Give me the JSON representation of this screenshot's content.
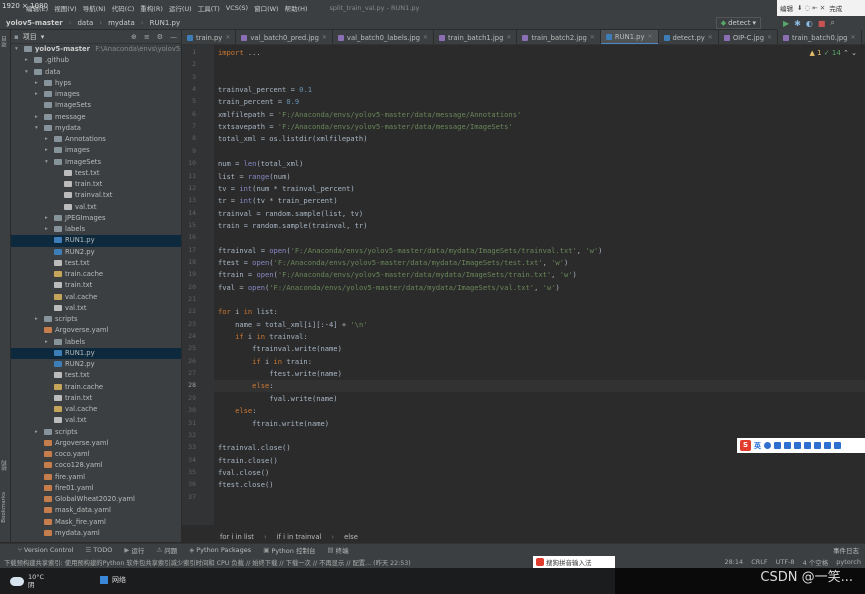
{
  "screen": {
    "resolution_badge": "1920 × 1080"
  },
  "menubar": {
    "items": [
      "编辑(E)",
      "视图(V)",
      "导航(N)",
      "代码(C)",
      "重构(R)",
      "运行(U)",
      "工具(T)",
      "VCS(S)",
      "窗口(W)",
      "帮助(H)"
    ],
    "window_title": "split_train_val.py - RUN1.py"
  },
  "navbar": {
    "breadcrumbs": [
      "yolov5-master",
      "data",
      "mydata",
      "RUN1.py"
    ],
    "run_config": "detect"
  },
  "ime_top": {
    "labels": [
      "编辑",
      "完成"
    ]
  },
  "left_strip": {
    "labels": [
      "项目",
      "结构",
      "Bookmarks"
    ]
  },
  "project": {
    "header": "项目",
    "root_label": "yolov5-master",
    "root_path": "F:\\Anaconda\\envs\\yolov5-m",
    "items": [
      {
        "label": ".github",
        "kind": "folder",
        "depth": 1,
        "arrow": "▸"
      },
      {
        "label": "data",
        "kind": "folder",
        "depth": 1,
        "arrow": "▾"
      },
      {
        "label": "hyps",
        "kind": "folder",
        "depth": 2,
        "arrow": "▸"
      },
      {
        "label": "images",
        "kind": "folder",
        "depth": 2,
        "arrow": "▸"
      },
      {
        "label": "ImageSets",
        "kind": "folder",
        "depth": 2,
        "arrow": ""
      },
      {
        "label": "message",
        "kind": "folder",
        "depth": 2,
        "arrow": "▸"
      },
      {
        "label": "mydata",
        "kind": "folder",
        "depth": 2,
        "arrow": "▾"
      },
      {
        "label": "Annotations",
        "kind": "folder",
        "depth": 3,
        "arrow": "▸"
      },
      {
        "label": "images",
        "kind": "folder",
        "depth": 3,
        "arrow": "▸"
      },
      {
        "label": "ImageSets",
        "kind": "folder",
        "depth": 3,
        "arrow": "▾"
      },
      {
        "label": "test.txt",
        "kind": "txt",
        "depth": 4,
        "arrow": ""
      },
      {
        "label": "train.txt",
        "kind": "txt",
        "depth": 4,
        "arrow": ""
      },
      {
        "label": "trainval.txt",
        "kind": "txt",
        "depth": 4,
        "arrow": ""
      },
      {
        "label": "val.txt",
        "kind": "txt",
        "depth": 4,
        "arrow": ""
      },
      {
        "label": "JPEGImages",
        "kind": "folder",
        "depth": 3,
        "arrow": "▸"
      },
      {
        "label": "labels",
        "kind": "folder",
        "depth": 3,
        "arrow": "▸"
      },
      {
        "label": "RUN1.py",
        "kind": "py",
        "depth": 3,
        "arrow": "",
        "selected": true
      },
      {
        "label": "RUN2.py",
        "kind": "py",
        "depth": 3,
        "arrow": ""
      },
      {
        "label": "test.txt",
        "kind": "txt",
        "depth": 3,
        "arrow": ""
      },
      {
        "label": "train.cache",
        "kind": "cache",
        "depth": 3,
        "arrow": ""
      },
      {
        "label": "train.txt",
        "kind": "txt",
        "depth": 3,
        "arrow": ""
      },
      {
        "label": "val.cache",
        "kind": "cache",
        "depth": 3,
        "arrow": ""
      },
      {
        "label": "val.txt",
        "kind": "txt",
        "depth": 3,
        "arrow": ""
      },
      {
        "label": "scripts",
        "kind": "folder",
        "depth": 2,
        "arrow": "▸"
      },
      {
        "label": "Argoverse.yaml",
        "kind": "yaml",
        "depth": 2,
        "arrow": ""
      },
      {
        "label": "labels",
        "kind": "folder",
        "depth": 3,
        "arrow": "▸"
      },
      {
        "label": "RUN1.py",
        "kind": "py",
        "depth": 3,
        "arrow": "",
        "selected": true
      },
      {
        "label": "RUN2.py",
        "kind": "py",
        "depth": 3,
        "arrow": ""
      },
      {
        "label": "test.txt",
        "kind": "txt",
        "depth": 3,
        "arrow": ""
      },
      {
        "label": "train.cache",
        "kind": "cache",
        "depth": 3,
        "arrow": ""
      },
      {
        "label": "train.txt",
        "kind": "txt",
        "depth": 3,
        "arrow": ""
      },
      {
        "label": "val.cache",
        "kind": "cache",
        "depth": 3,
        "arrow": ""
      },
      {
        "label": "val.txt",
        "kind": "txt",
        "depth": 3,
        "arrow": ""
      },
      {
        "label": "scripts",
        "kind": "folder",
        "depth": 2,
        "arrow": "▸"
      },
      {
        "label": "Argoverse.yaml",
        "kind": "yaml",
        "depth": 2,
        "arrow": ""
      },
      {
        "label": "coco.yaml",
        "kind": "yaml",
        "depth": 2,
        "arrow": ""
      },
      {
        "label": "coco128.yaml",
        "kind": "yaml",
        "depth": 2,
        "arrow": ""
      },
      {
        "label": "fire.yaml",
        "kind": "yaml",
        "depth": 2,
        "arrow": ""
      },
      {
        "label": "fire01.yaml",
        "kind": "yaml",
        "depth": 2,
        "arrow": ""
      },
      {
        "label": "GlobalWheat2020.yaml",
        "kind": "yaml",
        "depth": 2,
        "arrow": ""
      },
      {
        "label": "mask_data.yaml",
        "kind": "yaml",
        "depth": 2,
        "arrow": ""
      },
      {
        "label": "Mask_fire.yaml",
        "kind": "yaml",
        "depth": 2,
        "arrow": ""
      },
      {
        "label": "mydata.yaml",
        "kind": "yaml",
        "depth": 2,
        "arrow": ""
      }
    ]
  },
  "tabs": [
    {
      "label": "train.py",
      "kind": "py"
    },
    {
      "label": "val_batch0_pred.jpg",
      "kind": "img"
    },
    {
      "label": "val_batch0_labels.jpg",
      "kind": "img"
    },
    {
      "label": "train_batch1.jpg",
      "kind": "img"
    },
    {
      "label": "train_batch2.jpg",
      "kind": "img"
    },
    {
      "label": "RUN1.py",
      "kind": "py",
      "active": true
    },
    {
      "label": "detect.py",
      "kind": "py"
    },
    {
      "label": "OIP-C.jpg",
      "kind": "img"
    },
    {
      "label": "train_batch0.jpg",
      "kind": "img"
    }
  ],
  "editor": {
    "inspection": {
      "warnings": "▲ 1",
      "ok": "✓ 14"
    },
    "current_line": 28,
    "lines": [
      {
        "n": "1",
        "text": "import ..."
      },
      {
        "n": "2",
        "text": ""
      },
      {
        "n": "3",
        "text": ""
      },
      {
        "n": "4",
        "text": "trainval_percent = 0.1"
      },
      {
        "n": "5",
        "text": "train_percent = 0.9"
      },
      {
        "n": "6",
        "text": "xmlfilepath = 'F:/Anaconda/envs/yolov5-master/data/message/Annotations'"
      },
      {
        "n": "7",
        "text": "txtsavepath = 'F:/Anaconda/envs/yolov5-master/data/message/ImageSets'"
      },
      {
        "n": "8",
        "text": "total_xml = os.listdir(xmlfilepath)"
      },
      {
        "n": "9",
        "text": ""
      },
      {
        "n": "10",
        "text": "num = len(total_xml)"
      },
      {
        "n": "11",
        "text": "list = range(num)"
      },
      {
        "n": "12",
        "text": "tv = int(num * trainval_percent)"
      },
      {
        "n": "13",
        "text": "tr = int(tv * train_percent)"
      },
      {
        "n": "14",
        "text": "trainval = random.sample(list, tv)"
      },
      {
        "n": "15",
        "text": "train = random.sample(trainval, tr)"
      },
      {
        "n": "16",
        "text": ""
      },
      {
        "n": "17",
        "text": "ftrainval = open('F:/Anaconda/envs/yolov5-master/data/mydata/ImageSets/trainval.txt', 'w')"
      },
      {
        "n": "18",
        "text": "ftest = open('F:/Anaconda/envs/yolov5-master/data/mydata/ImageSets/test.txt', 'w')"
      },
      {
        "n": "19",
        "text": "ftrain = open('F:/Anaconda/envs/yolov5-master/data/mydata/ImageSets/train.txt', 'w')"
      },
      {
        "n": "20",
        "text": "fval = open('F:/Anaconda/envs/yolov5-master/data/mydata/ImageSets/val.txt', 'w')"
      },
      {
        "n": "21",
        "text": ""
      },
      {
        "n": "22",
        "text": "for i in list:"
      },
      {
        "n": "23",
        "text": "    name = total_xml[i][:-4] + '\\n'"
      },
      {
        "n": "24",
        "text": "    if i in trainval:"
      },
      {
        "n": "25",
        "text": "        ftrainval.write(name)"
      },
      {
        "n": "26",
        "text": "        if i in train:"
      },
      {
        "n": "27",
        "text": "            ftest.write(name)"
      },
      {
        "n": "28",
        "text": "        else:"
      },
      {
        "n": "29",
        "text": "            fval.write(name)"
      },
      {
        "n": "30",
        "text": "    else:"
      },
      {
        "n": "31",
        "text": "        ftrain.write(name)"
      },
      {
        "n": "32",
        "text": ""
      },
      {
        "n": "33",
        "text": "ftrainval.close()"
      },
      {
        "n": "34",
        "text": "ftrain.close()"
      },
      {
        "n": "35",
        "text": "fval.close()"
      },
      {
        "n": "36",
        "text": "ftest.close()"
      },
      {
        "n": "37",
        "text": ""
      }
    ]
  },
  "ime_float": {
    "s_label": "S",
    "mode_label": "英"
  },
  "code_breadcrumb": [
    "for i in list",
    "if i in trainval",
    "else"
  ],
  "toolwindows": [
    {
      "icon": "⑂",
      "label": "Version Control"
    },
    {
      "icon": "☰",
      "label": "TODO"
    },
    {
      "icon": "▶",
      "label": "运行"
    },
    {
      "icon": "⚠",
      "label": "问题"
    },
    {
      "icon": "◈",
      "label": "Python Packages"
    },
    {
      "icon": "▣",
      "label": "Python 控制台"
    },
    {
      "icon": "▤",
      "label": "终端"
    }
  ],
  "event_log": "事件日志",
  "status": {
    "message": "下载预构建共享索引: 使用预构建的Python 软件包共享索引减少索引时间和 CPU 负载 // 始终下载 // 下载一次 // 不再显示 // 配置... (昨天 22:53)",
    "position": "28:14",
    "line_sep": "CRLF",
    "encoding": "UTF-8",
    "indent": "4 个空格",
    "interpreter": "pytorch"
  },
  "ime_popup": {
    "label": "搜狗拼音输入法"
  },
  "taskbar": {
    "temp": "10°C",
    "weather": "阴",
    "network": "网络"
  },
  "watermark": "CSDN @一笑..."
}
